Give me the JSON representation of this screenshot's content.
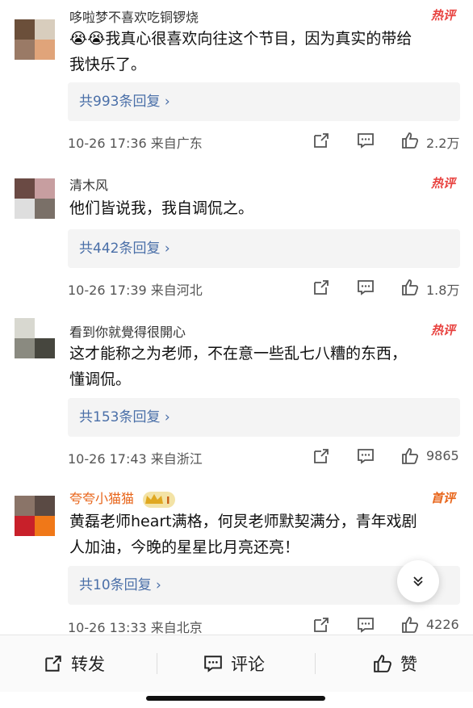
{
  "comments": [
    {
      "username": "哆啦梦不喜欢吃铜锣烧",
      "badge": "热评",
      "text": "😭😭我真心很喜欢向往这个节目，因为真实的带给\n我快乐了。",
      "replies": "共993条回复 ›",
      "time": "10-26 17:36",
      "location": "来自广东",
      "likes": "2.2万",
      "avatar_colors": [
        "#6b4f3a",
        "#d8cdbd",
        "#9a7a66",
        "#e0a47a"
      ]
    },
    {
      "username": "清木风",
      "badge": "热评",
      "text": "他们皆说我，我自调侃之。",
      "replies": "共442条回复 ›",
      "time": "10-26 17:39",
      "location": "来自河北",
      "likes": "1.8万",
      "avatar_colors": [
        "#6a4a44",
        "#c79ea0",
        "#dedede",
        "#7a7068"
      ]
    },
    {
      "username": "看到你就覺得很開心",
      "badge": "热评",
      "text": "这才能称之为老师，不在意一些乱七八糟的东西，\n懂调侃。",
      "replies": "共153条回复 ›",
      "time": "10-26 17:43",
      "location": "来自浙江",
      "likes": "9865",
      "avatar_colors": [
        "#d8d8d0",
        "#ffffff",
        "#8a8a80",
        "#46463e"
      ]
    },
    {
      "username": "夸夸小猫猫",
      "badge": "首评",
      "text": "黄磊老师heart满格，何炅老师默契满分，青年戏剧\n人加油，今晚的星星比月亮还亮！",
      "replies": "共10条回复 ›",
      "time": "10-26 13:33",
      "location": "来自北京",
      "likes": "4226",
      "avatar_colors": [
        "#8a7468",
        "#5a4a44",
        "#c8202a",
        "#f07818"
      ]
    }
  ],
  "vip_level": "I",
  "bottom_bar": {
    "repost": "转发",
    "comment": "评论",
    "like": "赞"
  },
  "colors": {
    "hot_badge": "#e8423f",
    "reply_link": "#4a6fa8",
    "vip_name": "#e8651a"
  }
}
